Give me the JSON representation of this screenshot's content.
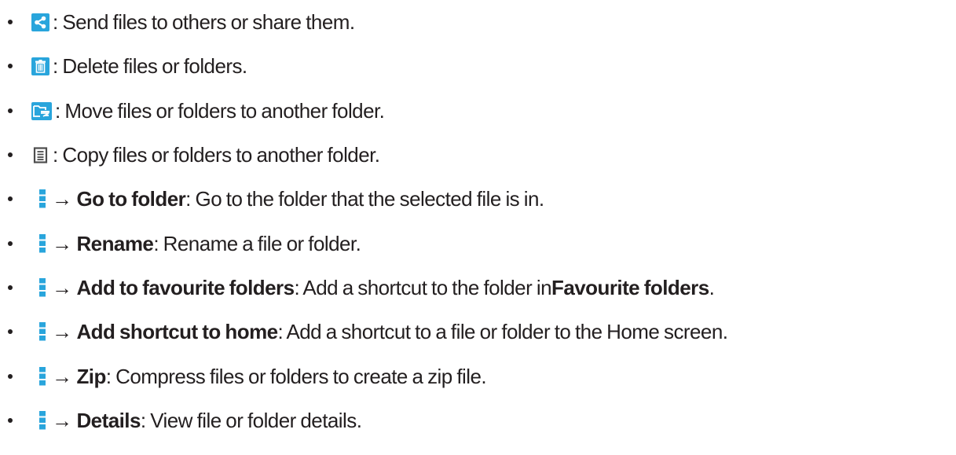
{
  "items": [
    {
      "icon": "share-icon",
      "text": ": Send files to others or share them."
    },
    {
      "icon": "trash-icon",
      "text": ": Delete files or folders."
    },
    {
      "icon": "move-folder-icon",
      "text": ": Move files or folders to another folder."
    },
    {
      "icon": "copy-icon",
      "text": ": Copy files or folders to another folder."
    },
    {
      "icon": "menu-dots-icon",
      "arrow": "→",
      "term": "Go to folder",
      "text": ": Go to the folder that the selected file is in."
    },
    {
      "icon": "menu-dots-icon",
      "arrow": "→",
      "term": "Rename",
      "text": ": Rename a file or folder."
    },
    {
      "icon": "menu-dots-icon",
      "arrow": "→",
      "term": "Add to favourite folders",
      "text": ": Add a shortcut to the folder in ",
      "term2": "Favourite folders",
      "text2": "."
    },
    {
      "icon": "menu-dots-icon",
      "arrow": "→",
      "term": "Add shortcut to home",
      "text": ": Add a shortcut to a file or folder to the Home screen."
    },
    {
      "icon": "menu-dots-icon",
      "arrow": "→",
      "term": "Zip",
      "text": ": Compress files or folders to create a zip file."
    },
    {
      "icon": "menu-dots-icon",
      "arrow": "→",
      "term": "Details",
      "text": ": View file or folder details."
    }
  ],
  "colors": {
    "icon_blue": "#29a5dc",
    "text": "#231f20"
  }
}
